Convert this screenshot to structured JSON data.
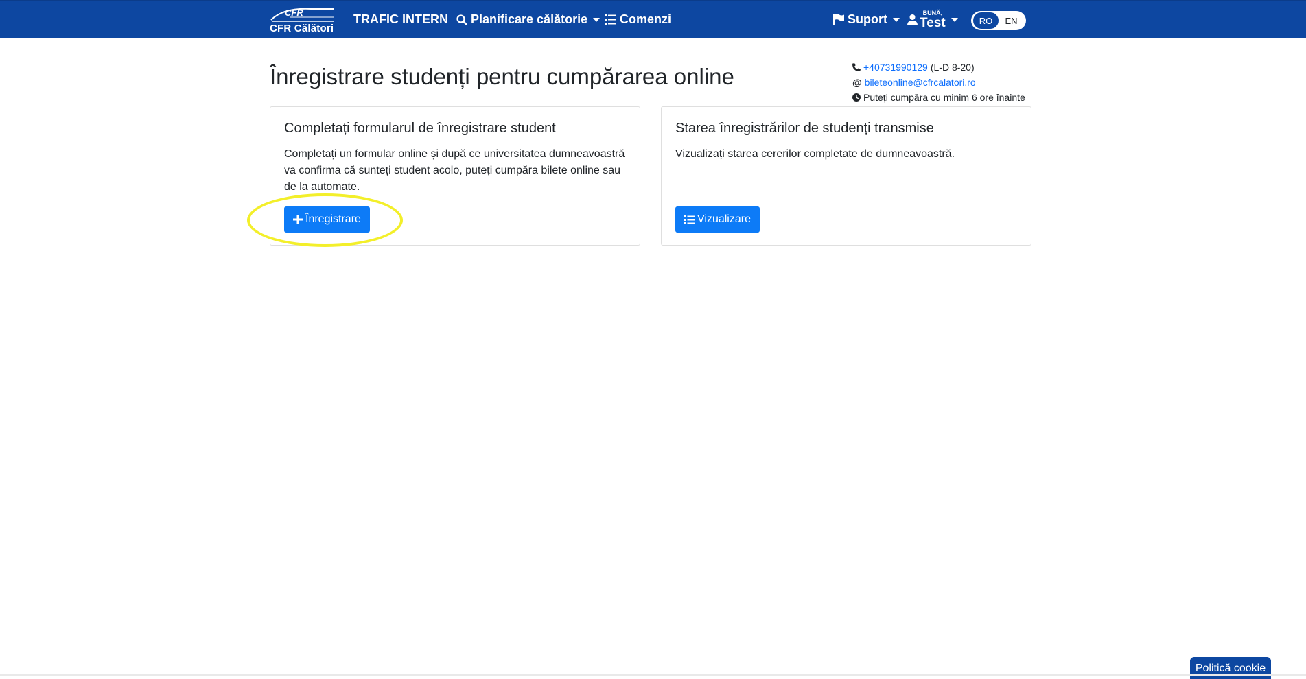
{
  "nav": {
    "brand_logo_text": "CFR",
    "brand_name": "CFR Călători",
    "items": [
      {
        "label": "TRAFIC INTERN",
        "icon": "none"
      },
      {
        "label": "Planificare călătorie",
        "icon": "search-icon"
      },
      {
        "label": "Comenzi",
        "icon": "list-icon"
      },
      {
        "label": "Suport",
        "icon": "flag-icon"
      }
    ],
    "user": {
      "greeting": "BUNĂ,",
      "name": "Test"
    },
    "languages": {
      "active": "RO",
      "other": "EN"
    }
  },
  "page": {
    "title": "Înregistrare studenți pentru cumpărarea online",
    "contact": {
      "phone": "+40731990129",
      "phone_hours": "(L-D 8-20)",
      "email": "bileteonline@cfrcalatori.ro",
      "note": "Puteți cumpăra cu minim 6 ore înainte"
    }
  },
  "cards": [
    {
      "title": "Completați formularul de înregistrare student",
      "text": "Completați un formular online și după ce universitatea dumneavoastră va confirma că sunteți student acolo, puteți cumpăra bilete online sau de la automate.",
      "button": "Înregistrare"
    },
    {
      "title": "Starea înregistrărilor de studenți transmise",
      "text": "Vizualizați starea cererilor completate de dumneavoastră.",
      "button": "Vizualizare"
    }
  ],
  "cookie": {
    "label": "Politică cookie"
  },
  "colors": {
    "navbar": "#0d47a1",
    "primary_button": "#0d7bf7",
    "link": "#0d6efd",
    "highlight": "#f3ef2a"
  }
}
